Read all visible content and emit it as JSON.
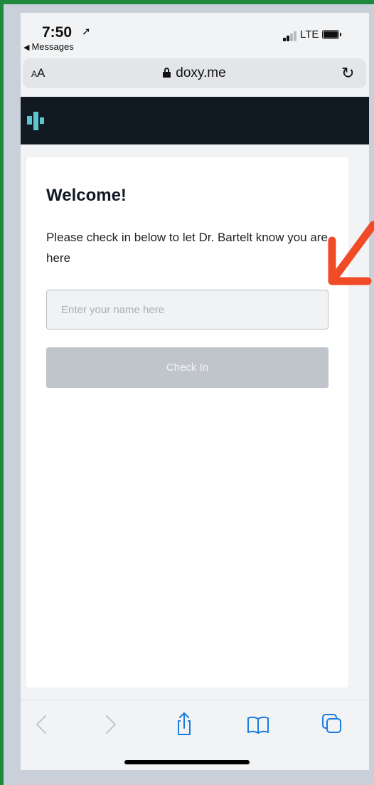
{
  "status_bar": {
    "time": "7:50",
    "back_app": "Messages",
    "network": "LTE",
    "icons": [
      "location-arrow-icon",
      "signal-icon",
      "battery-icon"
    ]
  },
  "address_bar": {
    "text_size_small": "A",
    "text_size_large": "A",
    "url": "doxy.me",
    "icons": [
      "lock-icon",
      "reload-icon"
    ]
  },
  "site_header": {
    "logo_icon": "doxy-logo-icon"
  },
  "checkin": {
    "title": "Welcome!",
    "instructions": "Please check in below to let Dr. Bartelt know you are here",
    "name_placeholder": "Enter your name here",
    "name_value": "",
    "button_label": "Check In"
  },
  "toolbar": {
    "icons": [
      "back-icon",
      "forward-icon",
      "share-icon",
      "bookmarks-icon",
      "tabs-icon"
    ]
  },
  "colors": {
    "frame_border": "#1e8a3e",
    "background": "#c9d0d9",
    "site_header": "#111923",
    "logo": "#5cc6cc",
    "button_disabled": "#c0c4cb",
    "annotation_arrow": "#f04a27",
    "toolbar_icon": "#1a7be0"
  }
}
